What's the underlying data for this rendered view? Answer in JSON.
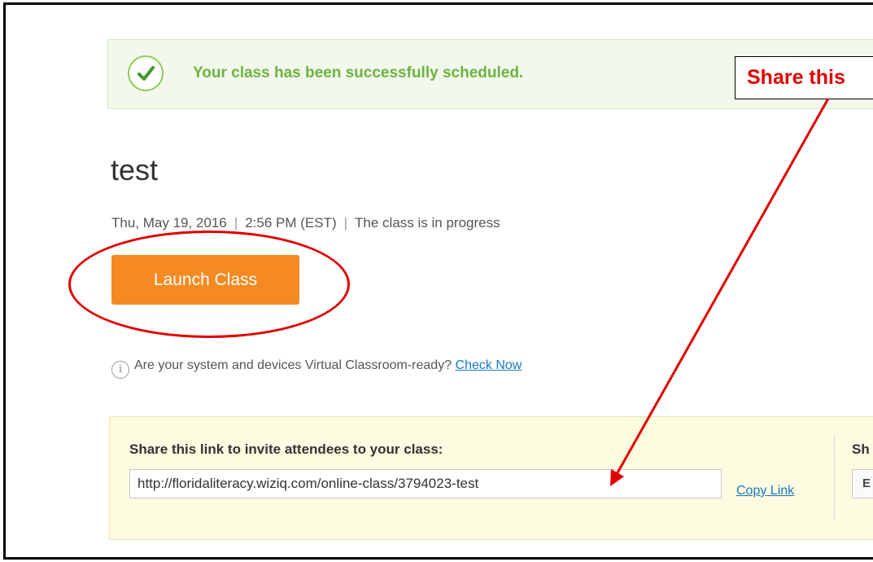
{
  "alert": {
    "message": "Your class has been successfully scheduled."
  },
  "callout": {
    "text": "Share this"
  },
  "class": {
    "title": "test",
    "date": "Thu, May 19, 2016",
    "time": "2:56 PM (EST)",
    "status": "The class is in progress",
    "launch_label": "Launch Class"
  },
  "readiness": {
    "question": "Are your system and devices Virtual Classroom-ready?",
    "link": "Check Now"
  },
  "share": {
    "label": "Share this link to invite attendees to your class:",
    "url": "http://floridaliteracy.wiziq.com/online-class/3794023-test",
    "copy_label": "Copy Link",
    "secondary_label": "Sh",
    "secondary_button": "E"
  },
  "colors": {
    "accent_orange": "#f58a22",
    "success_green": "#6db33f",
    "annotation_red": "#e00000",
    "link_blue": "#1a7ac7"
  }
}
